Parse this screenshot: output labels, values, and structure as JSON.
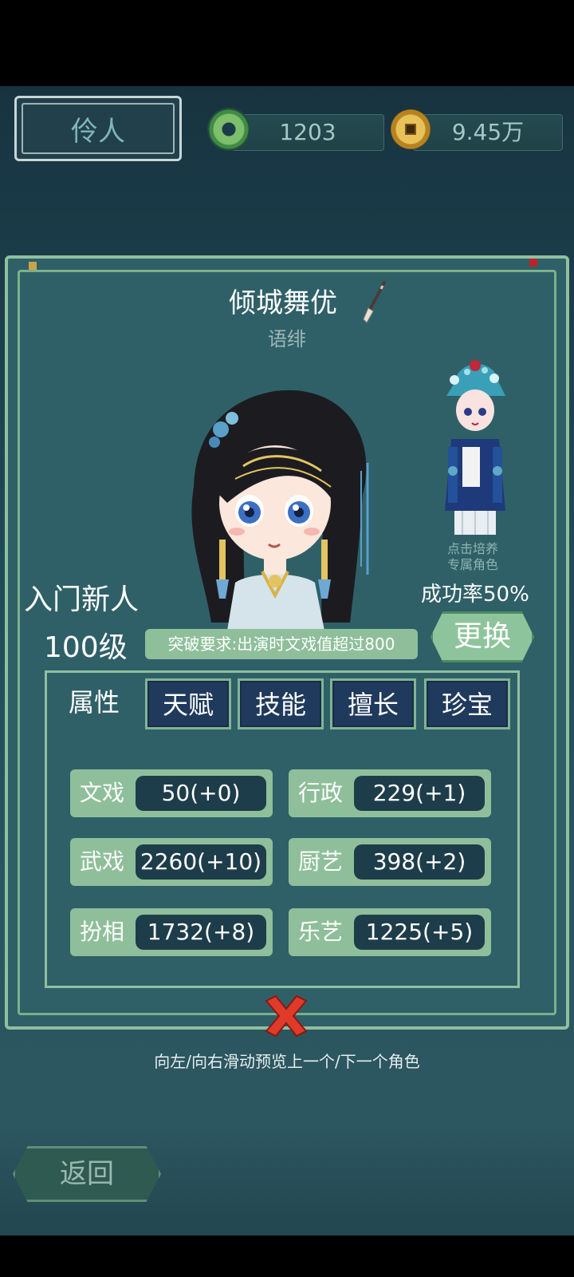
{
  "header": {
    "title": "伶人",
    "jade_amount": "1203",
    "coin_amount": "9.45万"
  },
  "character": {
    "name": "倾城舞优",
    "subtitle": "语绯",
    "rank": "入门新人",
    "level": "100级",
    "breakthrough": "突破要求:出演时文戏值超过800",
    "train_hint_line1": "点击培养",
    "train_hint_line2": "专属角色",
    "success_rate": "成功率50%",
    "change_label": "更换"
  },
  "tabs": [
    {
      "label": "属性",
      "active": true
    },
    {
      "label": "天赋",
      "active": false
    },
    {
      "label": "技能",
      "active": false
    },
    {
      "label": "擅长",
      "active": false
    },
    {
      "label": "珍宝",
      "active": false
    }
  ],
  "attributes": [
    {
      "label": "文戏",
      "value": "50(+0)"
    },
    {
      "label": "行政",
      "value": "229(+1)"
    },
    {
      "label": "武戏",
      "value": "2260(+10)"
    },
    {
      "label": "厨艺",
      "value": "398(+2)"
    },
    {
      "label": "扮相",
      "value": "1732(+8)"
    },
    {
      "label": "乐艺",
      "value": "1225(+5)"
    }
  ],
  "footer": {
    "hint": "向左/向右滑动预览上一个/下一个角色",
    "back_label": "返回"
  },
  "colors": {
    "panel": "#2f6068",
    "accent_green": "#8ebf9a",
    "value_bg": "#1e3d4b",
    "close_red": "#e03a2a"
  }
}
